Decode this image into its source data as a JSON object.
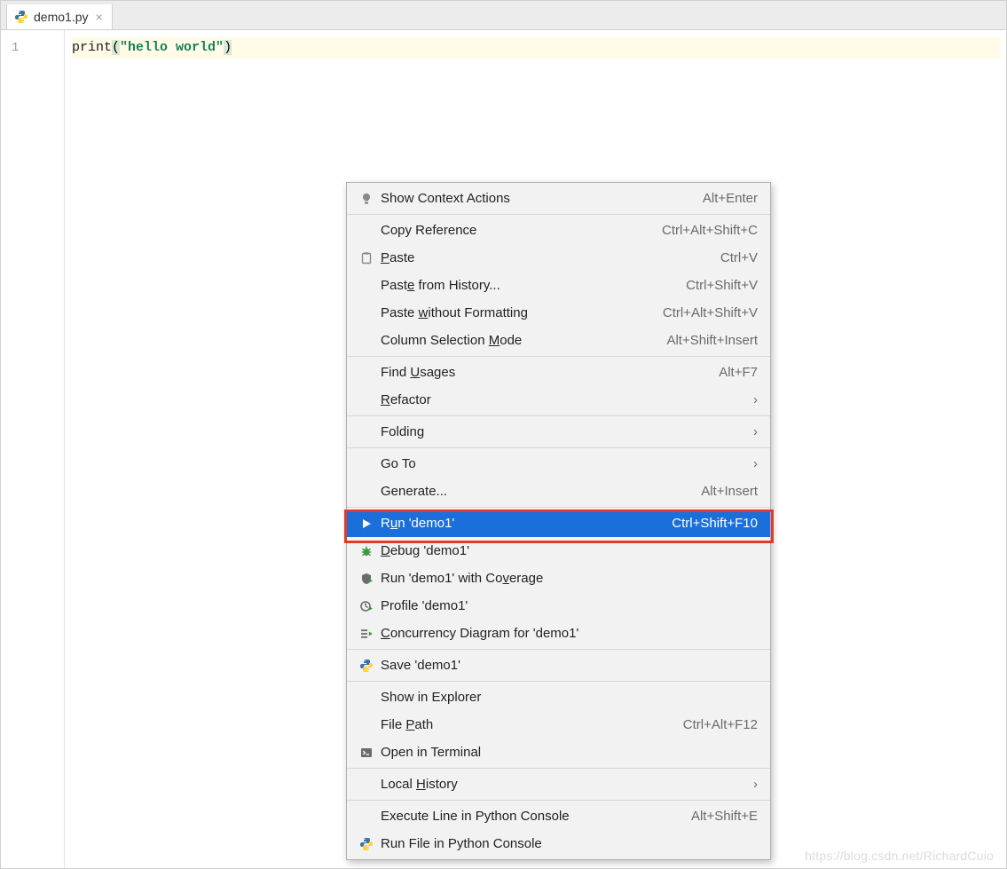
{
  "tab": {
    "filename": "demo1.py"
  },
  "editor": {
    "line_number": "1",
    "code": {
      "fn": "print",
      "open": "(",
      "str": "\"hello world\"",
      "close": ")"
    }
  },
  "menu": {
    "groups": [
      [
        {
          "icon": "lightbulb",
          "label_html": "Show Context Actions",
          "shortcut": "Alt+Enter"
        }
      ],
      [
        {
          "label_html": "Copy Reference",
          "shortcut": "Ctrl+Alt+Shift+C"
        },
        {
          "icon": "paste",
          "label_html": "<span class='u'>P</span>aste",
          "shortcut": "Ctrl+V"
        },
        {
          "label_html": "Past<span class='u'>e</span> from History...",
          "shortcut": "Ctrl+Shift+V"
        },
        {
          "label_html": "Paste <span class='u'>w</span>ithout Formatting",
          "shortcut": "Ctrl+Alt+Shift+V"
        },
        {
          "label_html": "Column Selection <span class='u'>M</span>ode",
          "shortcut": "Alt+Shift+Insert"
        }
      ],
      [
        {
          "label_html": "Find <span class='u'>U</span>sages",
          "shortcut": "Alt+F7"
        },
        {
          "label_html": "<span class='u'>R</span>efactor",
          "submenu": true
        }
      ],
      [
        {
          "label_html": "Folding",
          "submenu": true
        }
      ],
      [
        {
          "label_html": "Go To",
          "submenu": true
        },
        {
          "label_html": "Generate...",
          "shortcut": "Alt+Insert"
        }
      ],
      [
        {
          "icon": "run",
          "label_html": "R<span class='u'>u</span>n 'demo1'",
          "shortcut": "Ctrl+Shift+F10",
          "highlight": true
        },
        {
          "icon": "debug",
          "label_html": "<span class='u'>D</span>ebug 'demo1'"
        },
        {
          "icon": "coverage",
          "label_html": "Run 'demo1' with Co<span class='u'>v</span>erage"
        },
        {
          "icon": "profile",
          "label_html": "Profile 'demo1'"
        },
        {
          "icon": "concurrency",
          "label_html": "<span class='u'>C</span>oncurrency Diagram for 'demo1'"
        }
      ],
      [
        {
          "icon": "python",
          "label_html": "Save 'demo1'"
        }
      ],
      [
        {
          "label_html": "Show in Explorer"
        },
        {
          "label_html": "File <span class='u'>P</span>ath",
          "shortcut": "Ctrl+Alt+F12"
        },
        {
          "icon": "terminal",
          "label_html": "Open in Terminal"
        }
      ],
      [
        {
          "label_html": "Local <span class='u'>H</span>istory",
          "submenu": true
        }
      ],
      [
        {
          "label_html": "Execute Line in Python Console",
          "shortcut": "Alt+Shift+E"
        },
        {
          "icon": "python",
          "label_html": "Run File in Python Console"
        }
      ]
    ]
  },
  "watermark": "https://blog.csdn.net/RichardCuio"
}
